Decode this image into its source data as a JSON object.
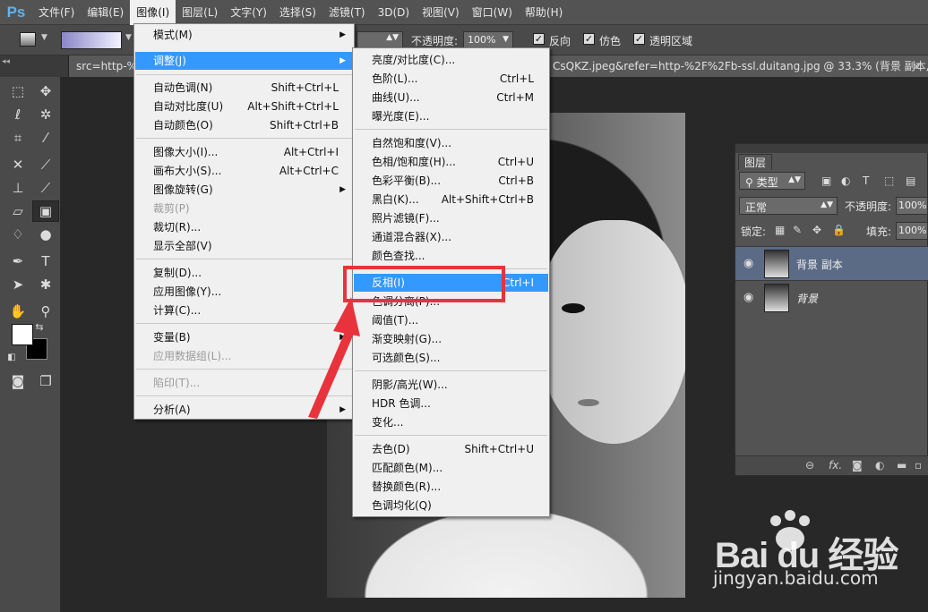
{
  "app": {
    "logo": "Ps"
  },
  "menubar": [
    "文件(F)",
    "编辑(E)",
    "图像(I)",
    "图层(L)",
    "文字(Y)",
    "选择(S)",
    "滤镜(T)",
    "3D(D)",
    "视图(V)",
    "窗口(W)",
    "帮助(H)"
  ],
  "options": {
    "opacity_label": "不透明度:",
    "opacity_value": "100%",
    "reverse_label": "反向",
    "dither_label": "仿色",
    "transparency_label": "透明区域"
  },
  "document_tab": {
    "left_text": "src=http-%2",
    "right_text": "CsQKZ.jpeg&refer=http-%2F%2Fb-ssl.duitang.jpg @ 33.3% (背景 副本, ...",
    "close": "×"
  },
  "image_menu": {
    "items": [
      {
        "label": "模式(M)",
        "shortcut": "",
        "submenu": true
      },
      {
        "label": "调整(J)",
        "shortcut": "",
        "submenu": true
      },
      {
        "label": "自动色调(N)",
        "shortcut": "Shift+Ctrl+L"
      },
      {
        "label": "自动对比度(U)",
        "shortcut": "Alt+Shift+Ctrl+L"
      },
      {
        "label": "自动颜色(O)",
        "shortcut": "Shift+Ctrl+B"
      },
      {
        "label": "图像大小(I)...",
        "shortcut": "Alt+Ctrl+I"
      },
      {
        "label": "画布大小(S)...",
        "shortcut": "Alt+Ctrl+C"
      },
      {
        "label": "图像旋转(G)",
        "shortcut": "",
        "submenu": true
      },
      {
        "label": "裁剪(P)",
        "shortcut": "",
        "disabled": true
      },
      {
        "label": "裁切(R)...",
        "shortcut": ""
      },
      {
        "label": "显示全部(V)",
        "shortcut": ""
      },
      {
        "label": "复制(D)...",
        "shortcut": ""
      },
      {
        "label": "应用图像(Y)...",
        "shortcut": ""
      },
      {
        "label": "计算(C)...",
        "shortcut": ""
      },
      {
        "label": "变量(B)",
        "shortcut": "",
        "submenu": true
      },
      {
        "label": "应用数据组(L)...",
        "shortcut": "",
        "disabled": true
      },
      {
        "label": "陷印(T)...",
        "shortcut": "",
        "disabled": true
      },
      {
        "label": "分析(A)",
        "shortcut": "",
        "submenu": true
      }
    ]
  },
  "adjust_menu": {
    "items": [
      {
        "label": "亮度/对比度(C)...",
        "shortcut": ""
      },
      {
        "label": "色阶(L)...",
        "shortcut": "Ctrl+L"
      },
      {
        "label": "曲线(U)...",
        "shortcut": "Ctrl+M"
      },
      {
        "label": "曝光度(E)...",
        "shortcut": ""
      },
      {
        "label": "自然饱和度(V)...",
        "shortcut": ""
      },
      {
        "label": "色相/饱和度(H)...",
        "shortcut": "Ctrl+U"
      },
      {
        "label": "色彩平衡(B)...",
        "shortcut": "Ctrl+B"
      },
      {
        "label": "黑白(K)...",
        "shortcut": "Alt+Shift+Ctrl+B"
      },
      {
        "label": "照片滤镜(F)...",
        "shortcut": ""
      },
      {
        "label": "通道混合器(X)...",
        "shortcut": ""
      },
      {
        "label": "颜色查找...",
        "shortcut": ""
      },
      {
        "label": "反相(I)",
        "shortcut": "Ctrl+I"
      },
      {
        "label": "色调分离(P)...",
        "shortcut": ""
      },
      {
        "label": "阈值(T)...",
        "shortcut": ""
      },
      {
        "label": "渐变映射(G)...",
        "shortcut": ""
      },
      {
        "label": "可选颜色(S)...",
        "shortcut": ""
      },
      {
        "label": "阴影/高光(W)...",
        "shortcut": ""
      },
      {
        "label": "HDR 色调...",
        "shortcut": ""
      },
      {
        "label": "变化...",
        "shortcut": ""
      },
      {
        "label": "去色(D)",
        "shortcut": "Shift+Ctrl+U"
      },
      {
        "label": "匹配颜色(M)...",
        "shortcut": ""
      },
      {
        "label": "替换颜色(R)...",
        "shortcut": ""
      },
      {
        "label": "色调均化(Q)",
        "shortcut": ""
      }
    ]
  },
  "layers_panel": {
    "tab": "图层",
    "filter_label": "类型",
    "blend_mode": "正常",
    "opacity_label": "不透明度:",
    "opacity_value": "100%",
    "lock_label": "锁定:",
    "fill_label": "填充:",
    "fill_value": "100%",
    "layers": [
      {
        "name": "背景 副本",
        "active": true
      },
      {
        "name": "背景",
        "active": false
      }
    ]
  },
  "watermark": {
    "brand": "Bai du 经验",
    "url": "jingyan.baidu.com"
  },
  "colors": {
    "highlight": "#3399ff",
    "annotation": "#e8333c",
    "menu_bg": "#f0f0f0"
  }
}
